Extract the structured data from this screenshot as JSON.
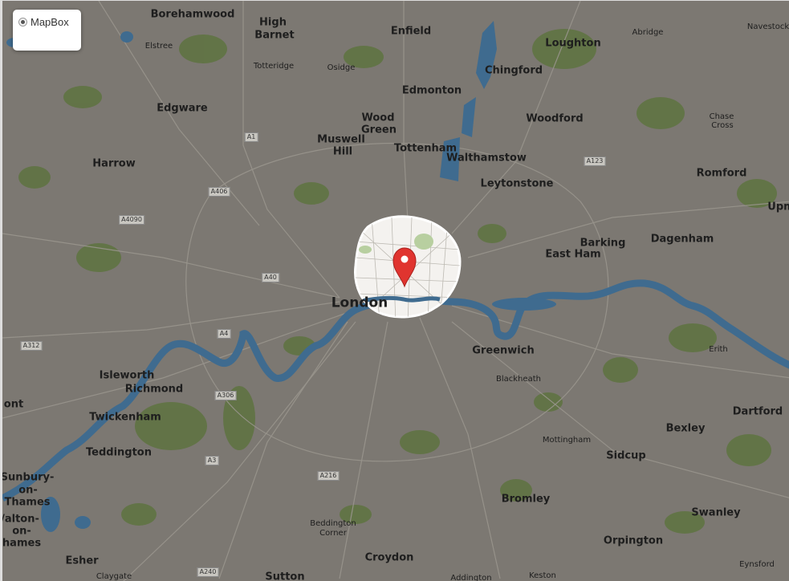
{
  "layer_control": {
    "selected": "MapBox"
  },
  "places": [
    {
      "name": "Borehamwood",
      "size": "lg"
    },
    {
      "name": "High",
      "size": "lg"
    },
    {
      "name": "Barnet",
      "size": "lg"
    },
    {
      "name": "Enfield",
      "size": "lg"
    },
    {
      "name": "Loughton",
      "size": "lg"
    },
    {
      "name": "Abridge",
      "size": "sm"
    },
    {
      "name": "Navestock",
      "size": "sm"
    },
    {
      "name": "Elstree",
      "size": "sm"
    },
    {
      "name": "Totteridge",
      "size": "sm"
    },
    {
      "name": "Osidge",
      "size": "sm"
    },
    {
      "name": "Chingford",
      "size": "lg"
    },
    {
      "name": "Edmonton",
      "size": "lg"
    },
    {
      "name": "Edgware",
      "size": "lg"
    },
    {
      "name": "Wood",
      "size": "lg"
    },
    {
      "name": "Green",
      "size": "lg"
    },
    {
      "name": "Woodford",
      "size": "lg"
    },
    {
      "name": "Chase",
      "size": "sm"
    },
    {
      "name": "Cross",
      "size": "sm"
    },
    {
      "name": "Muswell",
      "size": "lg"
    },
    {
      "name": "Hill",
      "size": "lg"
    },
    {
      "name": "Tottenham",
      "size": "lg"
    },
    {
      "name": "Walthamstow",
      "size": "lg"
    },
    {
      "name": "Harrow",
      "size": "lg"
    },
    {
      "name": "Romford",
      "size": "lg"
    },
    {
      "name": "Leytonstone",
      "size": "lg"
    },
    {
      "name": "Upm",
      "size": "lg"
    },
    {
      "name": "Barking",
      "size": "lg"
    },
    {
      "name": "Dagenham",
      "size": "lg"
    },
    {
      "name": "East Ham",
      "size": "lg"
    },
    {
      "name": "London",
      "size": "xl"
    },
    {
      "name": "Greenwich",
      "size": "lg"
    },
    {
      "name": "Erith",
      "size": "sm"
    },
    {
      "name": "Blackheath",
      "size": "sm"
    },
    {
      "name": "Isleworth",
      "size": "lg"
    },
    {
      "name": "Richmond",
      "size": "lg"
    },
    {
      "name": "ont",
      "size": "lg"
    },
    {
      "name": "Dartford",
      "size": "lg"
    },
    {
      "name": "Twickenham",
      "size": "lg"
    },
    {
      "name": "Bexley",
      "size": "lg"
    },
    {
      "name": "Mottingham",
      "size": "sm"
    },
    {
      "name": "Teddington",
      "size": "lg"
    },
    {
      "name": "Sidcup",
      "size": "lg"
    },
    {
      "name": "Sunbury-",
      "size": "lg"
    },
    {
      "name": "on-",
      "size": "lg"
    },
    {
      "name": "Thames",
      "size": "lg"
    },
    {
      "name": "Bromley",
      "size": "lg"
    },
    {
      "name": "Swanley",
      "size": "lg"
    },
    {
      "name": "/alton-",
      "size": "lg"
    },
    {
      "name": "on-",
      "size": "lg"
    },
    {
      "name": "hames",
      "size": "lg"
    },
    {
      "name": "Beddington",
      "size": "sm"
    },
    {
      "name": "Corner",
      "size": "sm"
    },
    {
      "name": "Orpington",
      "size": "lg"
    },
    {
      "name": "Esher",
      "size": "lg"
    },
    {
      "name": "Croydon",
      "size": "lg"
    },
    {
      "name": "Eynsford",
      "size": "sm"
    },
    {
      "name": "Claygate",
      "size": "sm"
    },
    {
      "name": "Sutton",
      "size": "lg"
    },
    {
      "name": "Addington",
      "size": "sm"
    },
    {
      "name": "Keston",
      "size": "sm"
    }
  ],
  "roads": [
    "A1",
    "A123",
    "A406",
    "A4090",
    "A40",
    "A4",
    "A312",
    "A306",
    "A3",
    "A216",
    "A240"
  ],
  "icons": {
    "marker": "map-marker-icon"
  },
  "colors": {
    "land": "#7c7872",
    "park": "#5e7340",
    "water": "#3f6b8f",
    "marker": "#e0342f",
    "highlight": "#f4f2ef"
  }
}
